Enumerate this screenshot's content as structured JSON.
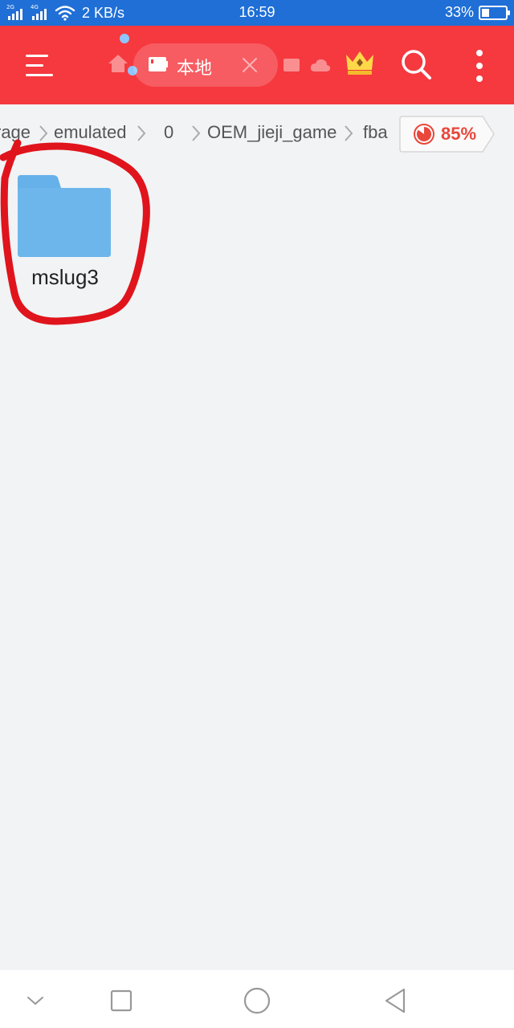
{
  "status_bar": {
    "sim1_label": "2G",
    "sim2_label": "4G",
    "network_speed": "2 KB/s",
    "time": "16:59",
    "battery_percent": "33%",
    "battery_level": 0.33
  },
  "app_bar": {
    "tab_label": "本地",
    "icons": {
      "menu": "hamburger-menu-icon",
      "home": "home-icon",
      "tab": "sd-card-icon",
      "close": "close-icon",
      "window": "window-icon",
      "cloud": "cloud-icon",
      "vip": "crown-icon",
      "search": "search-icon",
      "more": "more-vertical-icon"
    }
  },
  "breadcrumb": {
    "items": [
      "rage",
      "emulated",
      "0",
      "OEM_jieji_game",
      "fba"
    ],
    "storage_used": "85%",
    "storage_fraction": 0.85
  },
  "files": [
    {
      "name": "mslug3",
      "type": "folder"
    }
  ],
  "nav_bar": {
    "icons": [
      "chevron-down-icon",
      "square-icon",
      "circle-icon",
      "back-triangle-icon"
    ]
  },
  "colors": {
    "status_bar": "#1f6fd6",
    "app_bar": "#f5393f",
    "background": "#f2f3f5",
    "folder": "#66b1ea",
    "annotation": "#e0141c",
    "storage_accent": "#e9473b"
  }
}
